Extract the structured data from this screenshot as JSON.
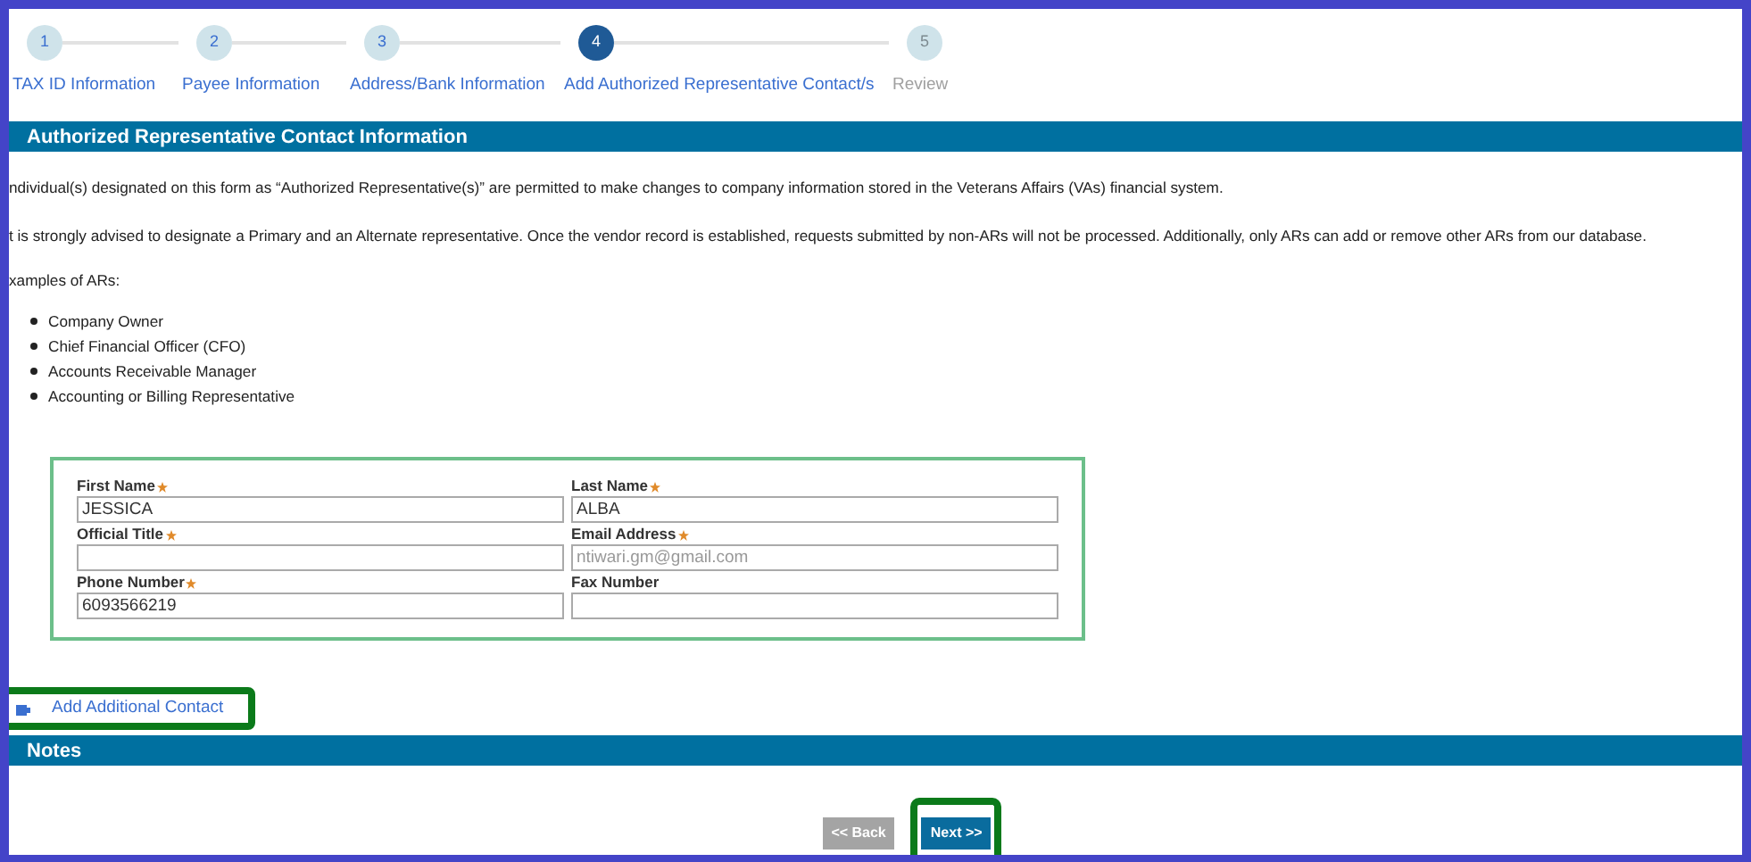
{
  "steps": [
    {
      "number": "1",
      "label": "TAX ID Information",
      "completed": true,
      "selected": false
    },
    {
      "number": "2",
      "label": "Payee Information",
      "completed": true,
      "selected": false
    },
    {
      "number": "3",
      "label": "Address/Bank Information",
      "completed": true,
      "selected": false
    },
    {
      "number": "4",
      "label": "Add Authorized Representative Contact/s",
      "completed": false,
      "selected": true
    },
    {
      "number": "5",
      "label": "Review",
      "completed": false,
      "selected": false
    }
  ],
  "section_title": "Authorized Representative Contact Information",
  "paragraphs": [
    "ndividual(s) designated on this form as “Authorized Representative(s)” are permitted to make changes to company information stored in the Veterans Affairs (VAs) financial system.",
    "t is strongly advised to designate a Primary and an Alternate representative. Once the vendor record is established, requests submitted by non-ARs will not be processed. Additionally, only ARs can add or remove other ARs from our database.",
    "xamples of ARs:"
  ],
  "examples": [
    "Company Owner",
    "Chief Financial Officer (CFO)",
    "Accounts Receivable Manager",
    "Accounting or Billing Representative"
  ],
  "fields": [
    {
      "label": "First Name",
      "required": true,
      "value": "JESSICA"
    },
    {
      "label": "Last Name",
      "required": true,
      "value": "ALBA"
    },
    {
      "label": "Official Title",
      "required": true
    },
    {
      "label": "Email Address",
      "required": true,
      "placeholder": "ntiwari.gm@gmail.com"
    },
    {
      "label": "Phone Number",
      "required": true,
      "value": "6093566219"
    },
    {
      "label": "Fax Number",
      "required": false
    }
  ],
  "add_contact": {
    "label": "Add Additional Contact",
    "highlighted": true
  },
  "notes_title": "Notes",
  "buttons": [
    {
      "label": "<< Back",
      "disabled": true,
      "highlighted": false
    },
    {
      "label": "Next >>",
      "disabled": false,
      "highlighted": true
    }
  ]
}
